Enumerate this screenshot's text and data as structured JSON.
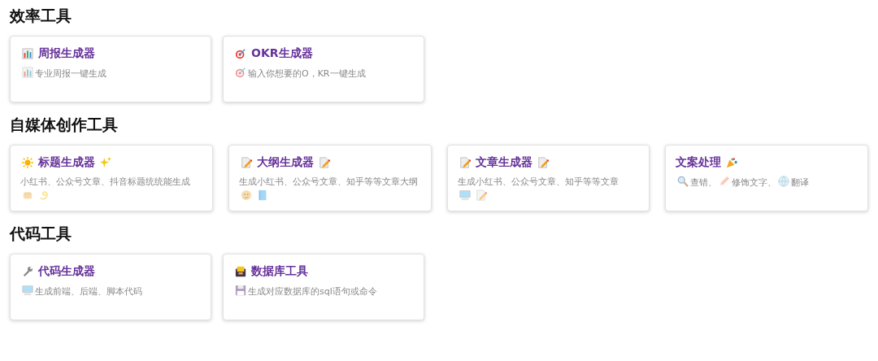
{
  "sections": [
    {
      "title": "效率工具",
      "cards": [
        {
          "title": "周报生成器",
          "description": "专业周报一键生成"
        },
        {
          "title": "OKR生成器",
          "description": "输入你想要的O，KR一键生成"
        }
      ]
    },
    {
      "title": "自媒体创作工具",
      "cards": [
        {
          "title": "标题生成器",
          "description": "小红书、公众号文章、抖音标题统统能生成"
        },
        {
          "title": "大纲生成器",
          "description": "生成小红书、公众号文章、知乎等等文章大纲"
        },
        {
          "title": "文章生成器",
          "description": "生成小红书、公众号文章、知乎等等文章"
        },
        {
          "title": "文案处理",
          "description_parts": [
            "查错、",
            "修饰文字、",
            "翻译"
          ]
        }
      ]
    },
    {
      "title": "代码工具",
      "cards": [
        {
          "title": "代码生成器",
          "description": "生成前端、后端、脚本代码"
        },
        {
          "title": "数据库工具",
          "description": "生成对应数据库的sql语句或命令"
        }
      ]
    }
  ]
}
